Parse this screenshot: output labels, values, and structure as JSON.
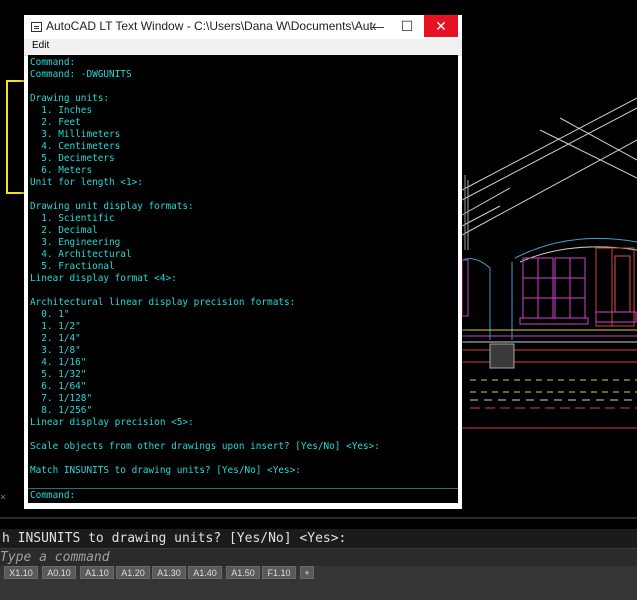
{
  "text_window": {
    "title": "AutoCAD LT Text Window - C:\\Users\\Dana W\\Documents\\AutoCAD D...",
    "minimize_label": "—",
    "maximize_label": "☐",
    "close_label": "✕",
    "menu": {
      "edit": "Edit"
    },
    "lines": [
      "Command:",
      "Command: -DWGUNITS",
      "",
      "Drawing units:",
      "  1. Inches",
      "  2. Feet",
      "  3. Millimeters",
      "  4. Centimeters",
      "  5. Decimeters",
      "  6. Meters",
      "Unit for length <1>:",
      "",
      "Drawing unit display formats:",
      "  1. Scientific",
      "  2. Decimal",
      "  3. Engineering",
      "  4. Architectural",
      "  5. Fractional",
      "Linear display format <4>:",
      "",
      "Architectural linear display precision formats:",
      "  0. 1\"",
      "  1. 1/2\"",
      "  2. 1/4\"",
      "  3. 1/8\"",
      "  4. 1/16\"",
      "  5. 1/32\"",
      "  6. 1/64\"",
      "  7. 1/128\"",
      "  8. 1/256\"",
      "Linear display precision <5>:",
      "",
      "Scale objects from other drawings upon insert? [Yes/No] <Yes>:",
      "",
      "Match INSUNITS to drawing units? [Yes/No] <Yes>:"
    ],
    "prompt_label": "Command:"
  },
  "command_line": {
    "history": "h INSUNITS to drawing units? [Yes/No] <Yes>:",
    "placeholder": "Type a command"
  },
  "layout_tabs": [
    "X1.10",
    "A0.10",
    "A1.10",
    "A1.20",
    "A1.30",
    "A1.40",
    "A1.50",
    "F1.10"
  ],
  "add_tab_label": "+",
  "colors": {
    "console_text": "#27d8d8",
    "highlight_box": "#f0e421",
    "close_button": "#e81123",
    "drawing_background": "#000000"
  }
}
